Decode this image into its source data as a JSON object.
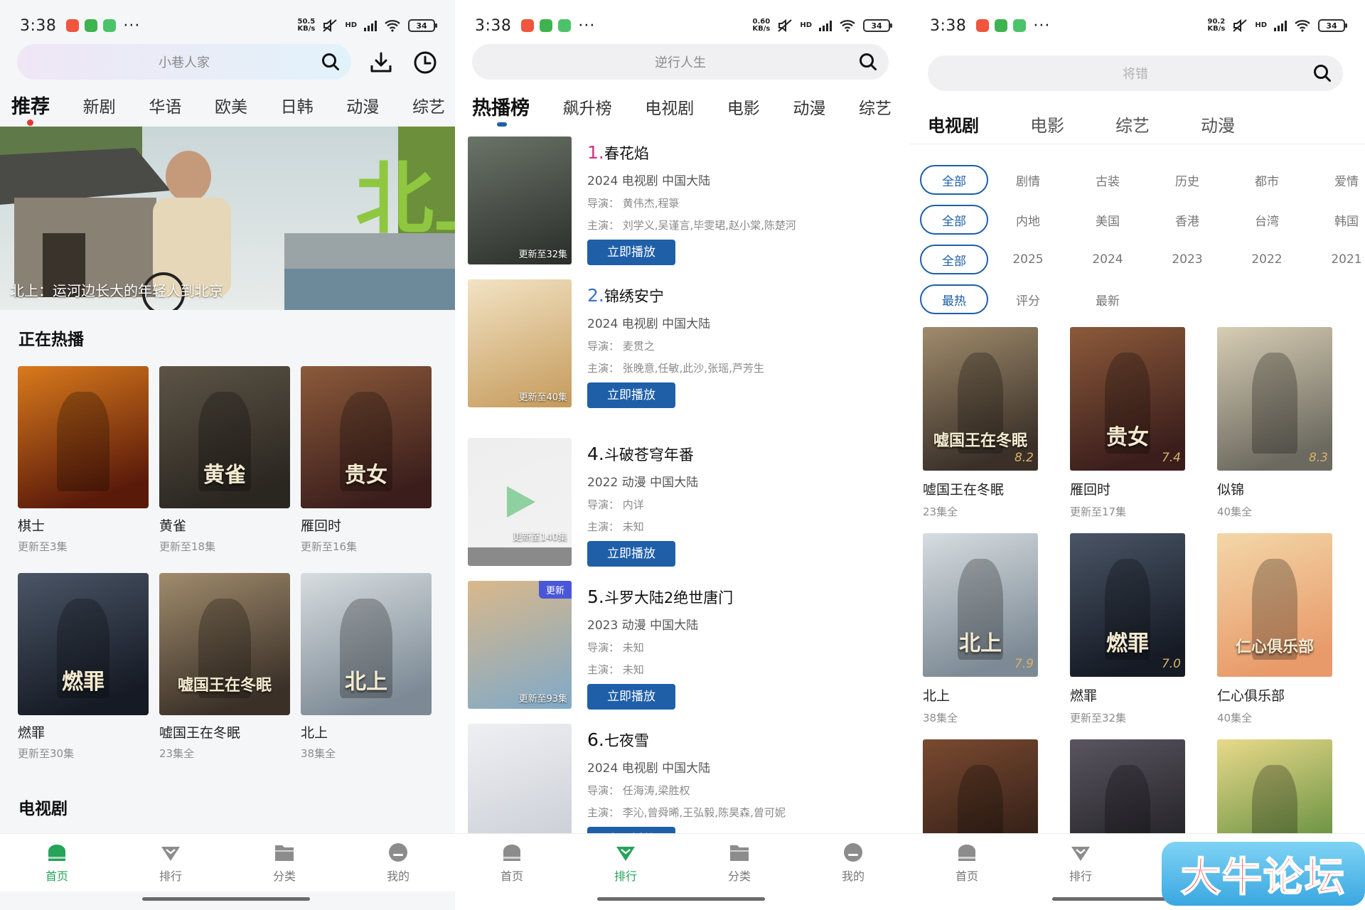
{
  "status": {
    "time": "3:38",
    "speeds": [
      {
        "top": "50.5",
        "bottom": "KB/s"
      },
      {
        "top": "0.60",
        "bottom": "KB/s"
      },
      {
        "top": "90.2",
        "bottom": "KB/s"
      }
    ],
    "hd": "HD",
    "battery": "34",
    "more": "···",
    "app_colors": [
      "#f0553d",
      "#3fb34f",
      "#4cc36a"
    ]
  },
  "home": {
    "search_placeholder": "小巷人家",
    "tabs": [
      "推荐",
      "新剧",
      "华语",
      "欧美",
      "日韩",
      "动漫",
      "综艺"
    ],
    "banner_caption": "北上：运河边长大的年轻人到北京",
    "section_hot": "正在热播",
    "section_tv": "电视剧",
    "hot": [
      {
        "name": "棋士",
        "sub": "更新至3集",
        "poster_text": "",
        "colors": [
          "#5a1a0a",
          "#d97a1c"
        ]
      },
      {
        "name": "黄雀",
        "sub": "更新至18集",
        "poster_text": "黄雀",
        "colors": [
          "#2a2620",
          "#5d5446"
        ]
      },
      {
        "name": "雁回时",
        "sub": "更新至16集",
        "poster_text": "贵女",
        "colors": [
          "#3b1e1c",
          "#8c5a3a"
        ]
      },
      {
        "name": "燃罪",
        "sub": "更新至30集",
        "poster_text": "燃罪",
        "colors": [
          "#151a24",
          "#4a5566"
        ]
      },
      {
        "name": "嘘国王在冬眠",
        "sub": "23集全",
        "poster_text": "嘘国王在冬眠",
        "colors": [
          "#3a3028",
          "#a08b6c"
        ]
      },
      {
        "name": "北上",
        "sub": "38集全",
        "poster_text": "北上",
        "colors": [
          "#7d8a95",
          "#d7dde0"
        ]
      }
    ]
  },
  "ranking": {
    "search_placeholder": "逆行人生",
    "tabs": [
      "热播榜",
      "飙升榜",
      "电视剧",
      "电影",
      "动漫",
      "综艺"
    ],
    "items": [
      {
        "num": "1.",
        "title": "春花焰",
        "meta": "2024  电视剧  中国大陆",
        "director": "导演：  黄伟杰,程箓",
        "cast": "主演：  刘学义,吴谨言,毕雯珺,赵小棠,陈楚河",
        "episodes": "更新至32集",
        "tag": "",
        "button": "立即播放",
        "num_color": "#d6317a",
        "colors": [
          "#2a2d2a",
          "#6b7468"
        ]
      },
      {
        "num": "2.",
        "title": "锦绣安宁",
        "meta": "2024  电视剧  中国大陆",
        "director": "导演：  麦贯之",
        "cast": "主演：  张晚意,任敏,此沙,张瑶,芦芳生",
        "episodes": "更新至40集",
        "tag": "",
        "button": "立即播放",
        "num_color": "#3b73c7",
        "colors": [
          "#c59a5a",
          "#f2e3c4"
        ]
      },
      {
        "num": "4.",
        "title": "斗破苍穹年番",
        "meta": "2022  动漫  中国大陆",
        "director": "导演：  内详",
        "cast": "主演：  未知",
        "episodes": "更新至140集",
        "tag": "",
        "button": "立即播放",
        "num_color": "#111111",
        "colors": [
          "#f2f2f2",
          "#eeeeee"
        ]
      },
      {
        "num": "5.",
        "title": "斗罗大陆2绝世唐门",
        "meta": "2023  动漫  中国大陆",
        "director": "导演：  未知",
        "cast": "主演：  未知",
        "episodes": "更新至93集",
        "tag": "更新",
        "button": "立即播放",
        "num_color": "#111111",
        "colors": [
          "#7fa9c9",
          "#d9b88a"
        ]
      },
      {
        "num": "6.",
        "title": "七夜雪",
        "meta": "2024  电视剧  中国大陆",
        "director": "导演：  任海涛,梁胜权",
        "cast": "主演：  李沁,曾舜晞,王弘毅,陈昊森,曾可妮",
        "episodes": "",
        "tag": "",
        "button": "立即播放",
        "num_color": "#111111",
        "colors": [
          "#c9ccd4",
          "#eef0f3"
        ]
      }
    ]
  },
  "category": {
    "search_placeholder": "将错",
    "tabs": [
      "电视剧",
      "电影",
      "综艺",
      "动漫"
    ],
    "filters": [
      {
        "selected": "全部",
        "options": [
          "剧情",
          "古装",
          "历史",
          "都市",
          "爱情"
        ]
      },
      {
        "selected": "全部",
        "options": [
          "内地",
          "美国",
          "香港",
          "台湾",
          "韩国"
        ]
      },
      {
        "selected": "全部",
        "options": [
          "2025",
          "2024",
          "2023",
          "2022",
          "2021"
        ]
      },
      {
        "selected": "最热",
        "options": [
          "评分",
          "最新"
        ]
      }
    ],
    "grid": [
      {
        "name": "嘘国王在冬眠",
        "sub": "23集全",
        "score": "8.2",
        "poster_text": "嘘国王在冬眠",
        "colors": [
          "#3a3028",
          "#a08b6c"
        ]
      },
      {
        "name": "雁回时",
        "sub": "更新至17集",
        "score": "7.4",
        "poster_text": "贵女",
        "colors": [
          "#3b1e1c",
          "#8c5a3a"
        ]
      },
      {
        "name": "似锦",
        "sub": "40集全",
        "score": "8.3",
        "poster_text": "",
        "colors": [
          "#6c6a60",
          "#d8cdb4"
        ]
      },
      {
        "name": "北上",
        "sub": "38集全",
        "score": "7.9",
        "poster_text": "北上",
        "colors": [
          "#7d8a95",
          "#d7dde0"
        ]
      },
      {
        "name": "燃罪",
        "sub": "更新至32集",
        "score": "7.0",
        "poster_text": "燃罪",
        "colors": [
          "#151a24",
          "#4a5566"
        ]
      },
      {
        "name": "仁心俱乐部",
        "sub": "40集全",
        "score": "",
        "poster_text": "仁心俱乐部",
        "colors": [
          "#e89a6a",
          "#f3d7a8"
        ]
      },
      {
        "name": "",
        "sub": "",
        "score": "",
        "poster_text": "",
        "colors": [
          "#2a1a14",
          "#7a4a30"
        ]
      },
      {
        "name": "",
        "sub": "",
        "score": "",
        "poster_text": "",
        "colors": [
          "#1e1e22",
          "#5a5560"
        ]
      },
      {
        "name": "",
        "sub": "",
        "score": "",
        "poster_text": "",
        "colors": [
          "#5a8a3a",
          "#e9d98a"
        ]
      }
    ]
  },
  "nav": {
    "items": [
      "首页",
      "排行",
      "分类",
      "我的"
    ],
    "active_color": "#27a35a",
    "inactive_color": "#8c8c8c"
  },
  "watermark": "大牛论坛"
}
